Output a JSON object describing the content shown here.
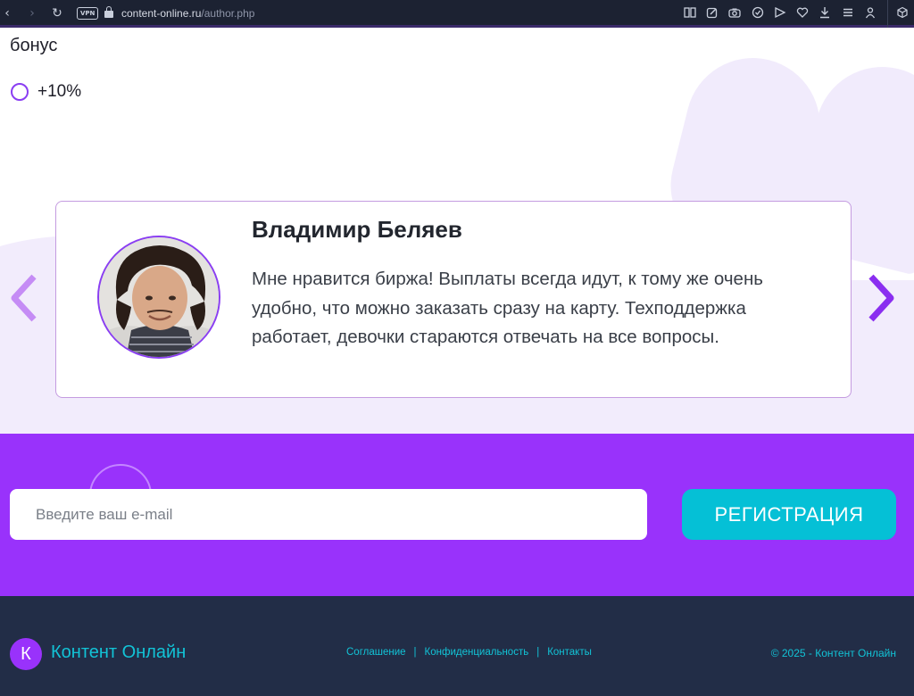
{
  "browser": {
    "url_host": "content-online.ru",
    "url_path": "/author.php",
    "vpn_label": "VPN",
    "icons": [
      "back-icon",
      "forward-icon",
      "reload-icon",
      "lock-icon",
      "reader-icon",
      "edit-icon",
      "camera-icon",
      "shield-icon",
      "send-icon",
      "heart-icon",
      "download-icon",
      "menu-icon",
      "profile-icon",
      "extension-icon"
    ]
  },
  "bonus": {
    "title": "бонус",
    "option_label": "+10%"
  },
  "review": {
    "name": "Владимир Беляев",
    "text": "Мне нравится биржа! Выплаты всегда идут, к тому же очень удобно, что можно заказать сразу на карту. Техподдержка работает, девочки стараются отвечать на все вопросы."
  },
  "subscribe": {
    "email_placeholder": "Введите ваш e-mail",
    "button_label": "РЕГИСТРАЦИЯ"
  },
  "footer": {
    "logo_letter": "К",
    "logo_text": "Контент Онлайн",
    "links": [
      "Соглашение",
      "Конфиденциальность",
      "Контакты"
    ],
    "separator": "|",
    "copyright": "© 2025 - Контент Онлайн"
  },
  "colors": {
    "accent_purple": "#9932fb",
    "accent_cyan": "#05c0d6",
    "footer_bg": "#222d47",
    "light_lavender": "#f2ecfc"
  }
}
